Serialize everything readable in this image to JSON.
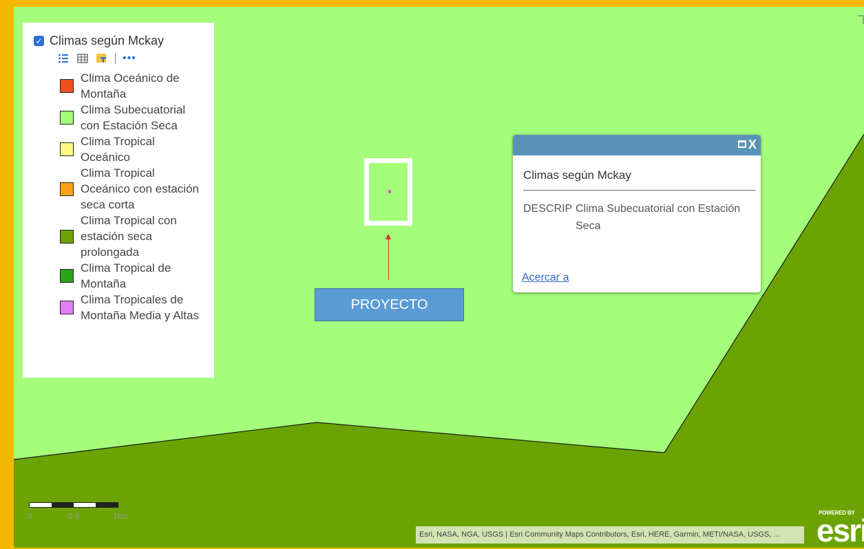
{
  "legend": {
    "layer_title": "Climas según Mckay",
    "checked": true,
    "tool_icons": [
      "legend-list-icon",
      "attribute-table-icon",
      "filter-icon",
      "more-options-icon"
    ],
    "more_label": "•••",
    "items": [
      {
        "label": "Clima Oceánico de Montaña",
        "color": "#ef4e1e"
      },
      {
        "label": "Clima Subecuatorial con Estación Seca",
        "color": "#a4fd7b"
      },
      {
        "label": "Clima Tropical Oceánico",
        "color": "#fdfb83"
      },
      {
        "label": "Clima Tropical Oceánico con estación seca corta",
        "color": "#fba11b"
      },
      {
        "label": "Clima Tropical con estación seca prolongada",
        "color": "#6ba402"
      },
      {
        "label": "Clima Tropical de Montaña",
        "color": "#2aa31a"
      },
      {
        "label": "Clima Tropicales de Montaña Media y Altas",
        "color": "#e07ef5"
      }
    ]
  },
  "map": {
    "light_zone_color": "#a4fd7b",
    "dark_zone_color": "#6ba402",
    "frame_color": "#f5b800"
  },
  "annotation": {
    "label": "PROYECTO"
  },
  "popup": {
    "title": "Climas según Mckay",
    "field_name": "DESCRIP",
    "field_value": "Clima Subecuatorial con Estación Seca",
    "zoom_link": "Acercar a",
    "close_glyph": "X"
  },
  "scalebar": {
    "ticks": [
      "0",
      "0.5",
      "1km"
    ]
  },
  "attribution": {
    "text": "Esri, NASA, NGA, USGS | Esri Community Maps Contributors, Esri, HERE, Garmin, METI/NASA, USGS, ..."
  },
  "logo": {
    "powered_by": "POWERED BY",
    "wordmark": "esri"
  }
}
